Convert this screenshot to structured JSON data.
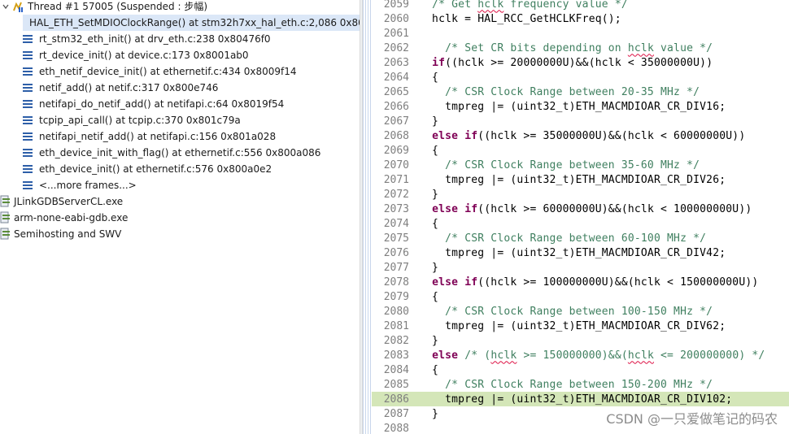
{
  "debug": {
    "thread_label": "Thread #1 57005 (Suspended : 步幅)",
    "frames": [
      "HAL_ETH_SetMDIOClockRange() at stm32h7xx_hal_eth.c:2,086 0x80",
      "rt_stm32_eth_init() at drv_eth.c:238 0x80476f0",
      "rt_device_init() at device.c:173 0x8001ab0",
      "eth_netif_device_init() at ethernetif.c:434 0x8009f14",
      "netif_add() at netif.c:317 0x800e746",
      "netifapi_do_netif_add() at netifapi.c:64 0x8019f54",
      "tcpip_api_call() at tcpip.c:370 0x801c79a",
      "netifapi_netif_add() at netifapi.c:156 0x801a028",
      "eth_device_init_with_flag() at ethernetif.c:556 0x800a086",
      "eth_device_init() at ethernetif.c:576 0x800a0e2",
      "<...more frames...>"
    ],
    "processes": [
      "JLinkGDBServerCL.exe",
      "arm-none-eabi-gdb.exe",
      "Semihosting and SWV"
    ]
  },
  "editor": {
    "line_numbers": [
      "2059",
      "2060",
      "2061",
      "2062",
      "2063",
      "2064",
      "2065",
      "2066",
      "2067",
      "2068",
      "2069",
      "2070",
      "2071",
      "2072",
      "2073",
      "2074",
      "2075",
      "2076",
      "2077",
      "2078",
      "2079",
      "2080",
      "2081",
      "2082",
      "2083",
      "2084",
      "2085",
      "2086",
      "2087",
      "2088"
    ],
    "current_line": "2086"
  },
  "watermark": "CSDN @一只爱做笔记的码农",
  "colors": {
    "selection": "#dbe7f7",
    "current_line": "#d4e6b8",
    "comment": "#3f7f5f",
    "keyword": "#7f0055",
    "line_number": "#7f7f7f"
  }
}
